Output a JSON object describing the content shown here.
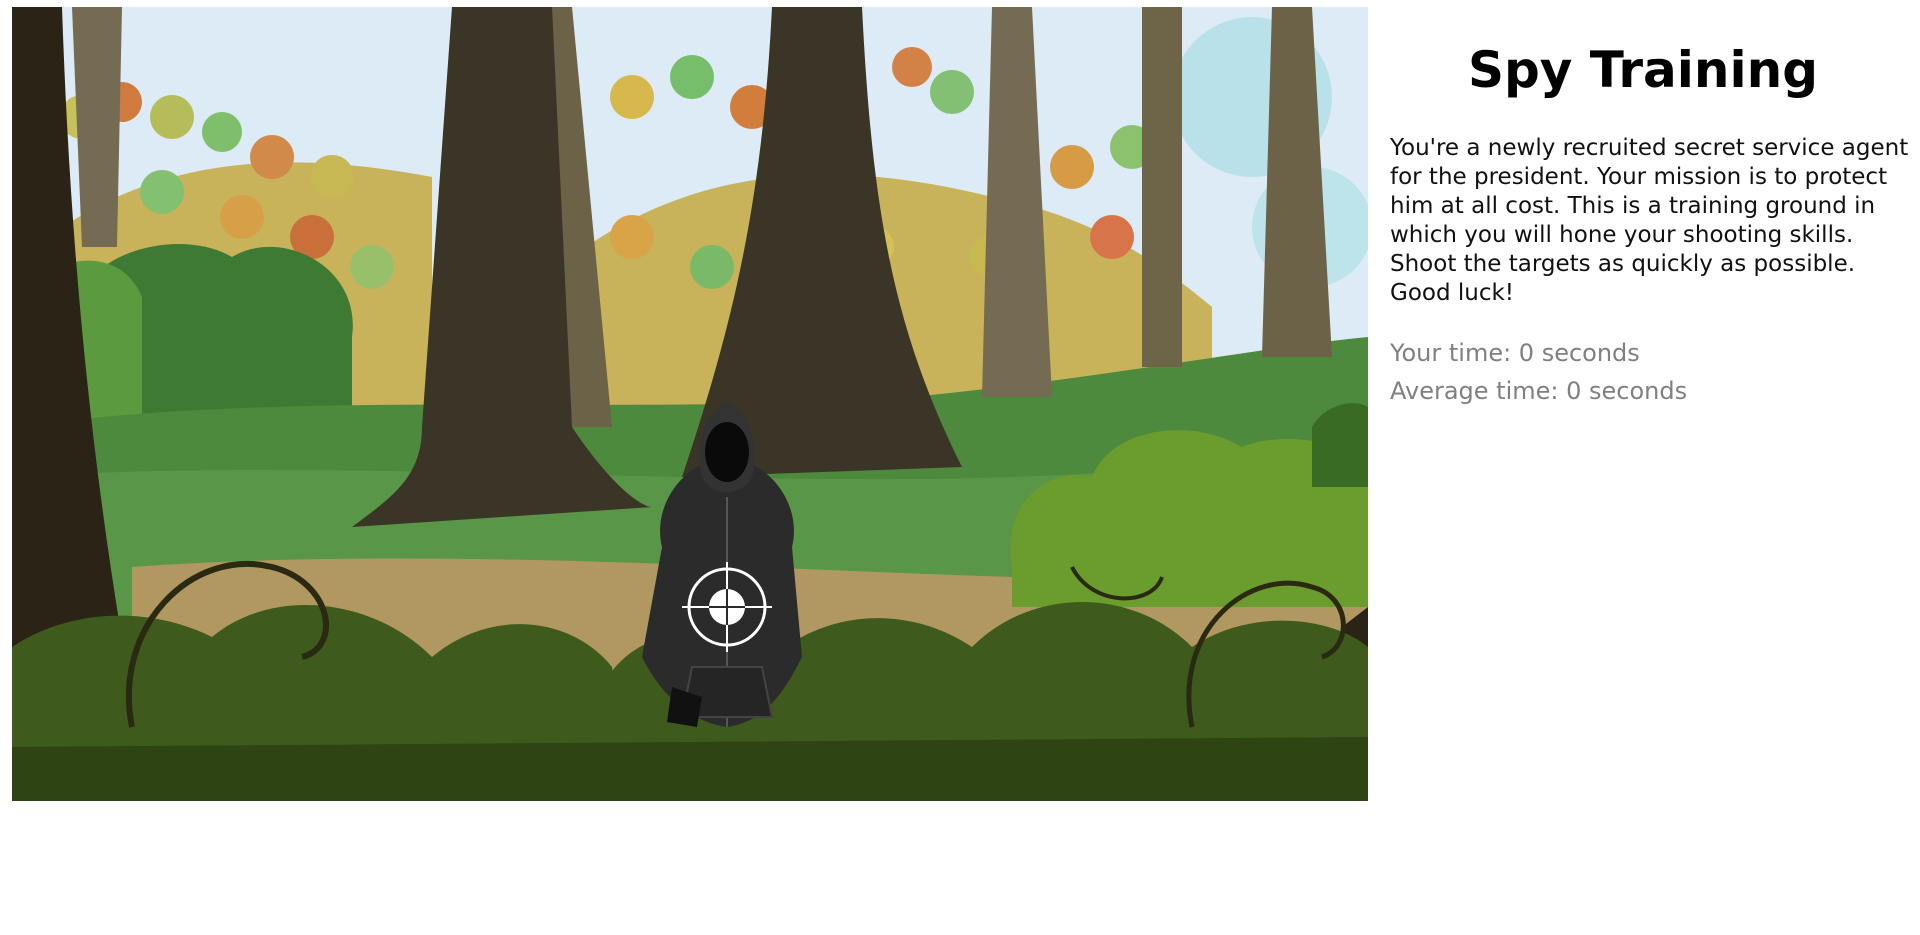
{
  "panel": {
    "title": "Spy Training",
    "intro": "You're a newly recruited secret service agent for the president. Your mission is to protect him at all cost. This is a training ground in which you will hone your shooting skills. Shoot the targets as quickly as possible. Good luck!",
    "your_time": "Your time: 0 seconds",
    "average_time": "Average time: 0 seconds"
  },
  "scene": {
    "background": "cartoon forest clearing",
    "target": "hooded-figure-target",
    "target_icon": "crosshair-icon"
  },
  "colors": {
    "sky": "#dcebf5",
    "foliage_autumn": "#c9b35a",
    "grass": "#4d8a3e",
    "path": "#b09860",
    "bush_dark": "#3e5a1c",
    "trunk": "#3a3526",
    "target_hoodie": "#2b2b2b"
  }
}
